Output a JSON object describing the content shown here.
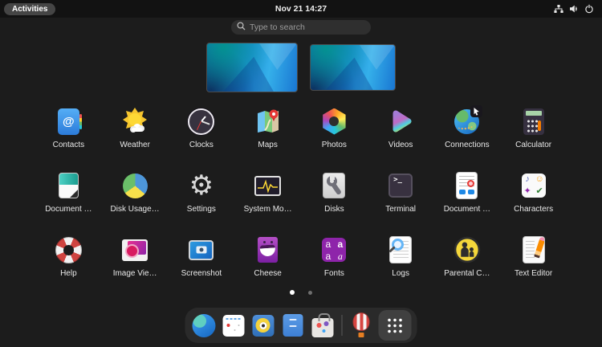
{
  "top_bar": {
    "activities_label": "Activities",
    "clock": "Nov 21 14:27",
    "status_icons": [
      "network-icon",
      "volume-icon",
      "power-icon"
    ]
  },
  "search": {
    "placeholder": "Type to search",
    "value": ""
  },
  "workspaces": {
    "count": 2,
    "active_index": 0
  },
  "app_grid": {
    "apps": [
      {
        "label": "Contacts",
        "icon": "contacts-icon"
      },
      {
        "label": "Weather",
        "icon": "weather-icon"
      },
      {
        "label": "Clocks",
        "icon": "clocks-icon"
      },
      {
        "label": "Maps",
        "icon": "maps-icon"
      },
      {
        "label": "Photos",
        "icon": "photos-icon"
      },
      {
        "label": "Videos",
        "icon": "videos-icon"
      },
      {
        "label": "Connections",
        "icon": "connections-icon"
      },
      {
        "label": "Calculator",
        "icon": "calculator-icon"
      },
      {
        "label": "Document …",
        "icon": "document-scanner-icon"
      },
      {
        "label": "Disk Usage…",
        "icon": "disk-usage-analyzer-icon"
      },
      {
        "label": "Settings",
        "icon": "settings-icon"
      },
      {
        "label": "System Mo…",
        "icon": "system-monitor-icon"
      },
      {
        "label": "Disks",
        "icon": "disks-icon"
      },
      {
        "label": "Terminal",
        "icon": "terminal-icon"
      },
      {
        "label": "Document …",
        "icon": "document-viewer-icon"
      },
      {
        "label": "Characters",
        "icon": "characters-icon"
      },
      {
        "label": "Help",
        "icon": "help-icon"
      },
      {
        "label": "Image Vie…",
        "icon": "image-viewer-icon"
      },
      {
        "label": "Screenshot",
        "icon": "screenshot-icon"
      },
      {
        "label": "Cheese",
        "icon": "cheese-icon"
      },
      {
        "label": "Fonts",
        "icon": "fonts-icon"
      },
      {
        "label": "Logs",
        "icon": "logs-icon"
      },
      {
        "label": "Parental C…",
        "icon": "parental-controls-icon"
      },
      {
        "label": "Text Editor",
        "icon": "text-editor-icon"
      }
    ],
    "page_indicator": {
      "pages": 2,
      "active_page": 1
    }
  },
  "dock": {
    "items": [
      "web-browser",
      "calendar",
      "music-player",
      "files",
      "software",
      "tour",
      "show-applications"
    ],
    "active_item": "show-applications"
  },
  "glyphs": {
    "contacts_at": "@",
    "settings_gear": "⚙",
    "terminal_prompt": ">_",
    "fonts": [
      "a",
      "a",
      "a",
      "a"
    ],
    "characters": [
      "♪",
      "☺",
      "✦",
      "✔"
    ]
  },
  "colors": {
    "background": "#1c1c1c",
    "top_bar": "#121212",
    "dock_bg": "#2a2a2a",
    "wallpaper_teal": "#00897b",
    "wallpaper_blue": "#1e88e5",
    "accent": "#3584e4"
  }
}
